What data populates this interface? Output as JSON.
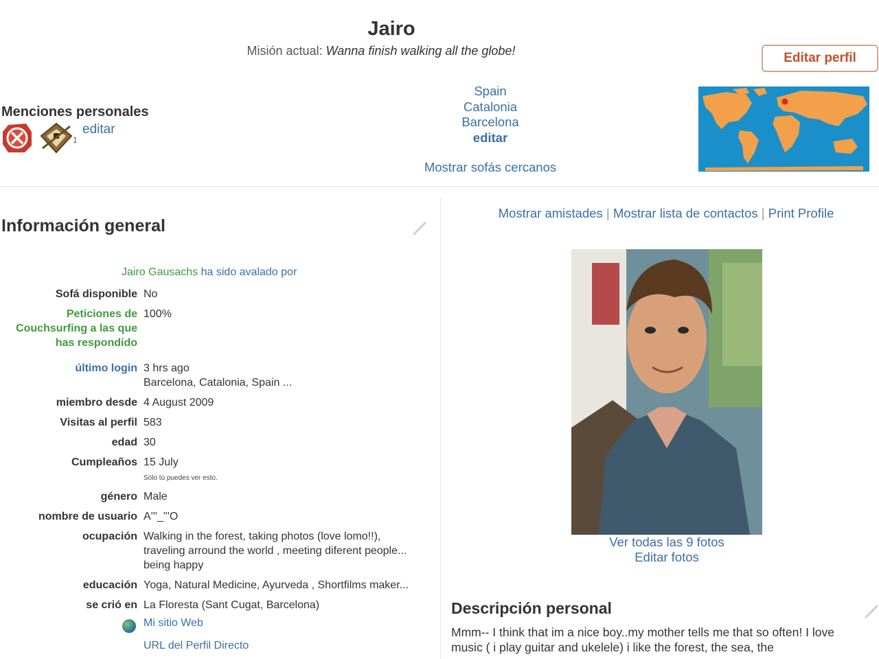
{
  "profile": {
    "name": "Jairo",
    "mission_label": "Misión actual:",
    "mission_text": "Wanna finish walking all the globe!",
    "edit_profile_label": "Editar perfil"
  },
  "mentions": {
    "title": "Menciones personales",
    "edit_label": "editar",
    "badge_count": "1"
  },
  "location": {
    "country": "Spain",
    "region": "Catalonia",
    "city": "Barcelona",
    "edit_label": "editar",
    "nearby_label": "Mostrar sofás cercanos"
  },
  "general": {
    "title": "Información general",
    "vouched_name": "Jairo Gausachs",
    "vouched_text": " ha sido ",
    "vouched_link": "avalado por",
    "rows": {
      "couch": {
        "label": "Sofá disponible",
        "value": "No"
      },
      "requests": {
        "label": "Peticiones de Couchsurfing a las que has respondido",
        "value": "100%"
      },
      "last_login": {
        "label": "último login",
        "value": "3 hrs ago",
        "value2": "Barcelona, Catalonia, Spain ..."
      },
      "member_since": {
        "label": "miembro desde",
        "value": "4 August 2009"
      },
      "visits": {
        "label": "Visitas al perfil",
        "value": "583"
      },
      "age": {
        "label": "edad",
        "value": "30"
      },
      "birthday": {
        "label": "Cumpleaños",
        "value": "15 July",
        "note": "Sólo tú puedes ver esto."
      },
      "gender": {
        "label": "género",
        "value": "Male"
      },
      "username": {
        "label": "nombre de usuario",
        "value": "A'''_'''O"
      },
      "occupation": {
        "label": "ocupación",
        "value": "Walking in the forest, taking photos (love lomo!!), traveling arround the world , meeting diferent people... being happy"
      },
      "education": {
        "label": "educación",
        "value": "Yoga, Natural Medicine, Ayurveda , Shortfilms maker..."
      },
      "grew_up": {
        "label": "se crió en",
        "value": "La Floresta (Sant Cugat, Barcelona)"
      }
    },
    "website_label": "Mi sitio Web",
    "direct_url_label": "URL del Perfil Directo"
  },
  "right": {
    "links": [
      "Mostrar amistades",
      "Mostrar lista de contactos",
      "Print Profile"
    ],
    "separator": "|",
    "see_photos": "Ver todas las 9 fotos",
    "edit_photos": "Editar fotos",
    "desc_title": "Descripción personal",
    "desc_text": "Mmm-- I think that im a nice boy..my mother tells me that so often! I love music ( i play guitar and ukelele) i like the forest, the sea, the"
  },
  "colors": {
    "link": "#3a6fa6",
    "green_label": "#3f9a3f",
    "edit_button_text": "#c0502a",
    "map_ocean": "#1a8fc9",
    "map_land": "#f2a04a"
  }
}
